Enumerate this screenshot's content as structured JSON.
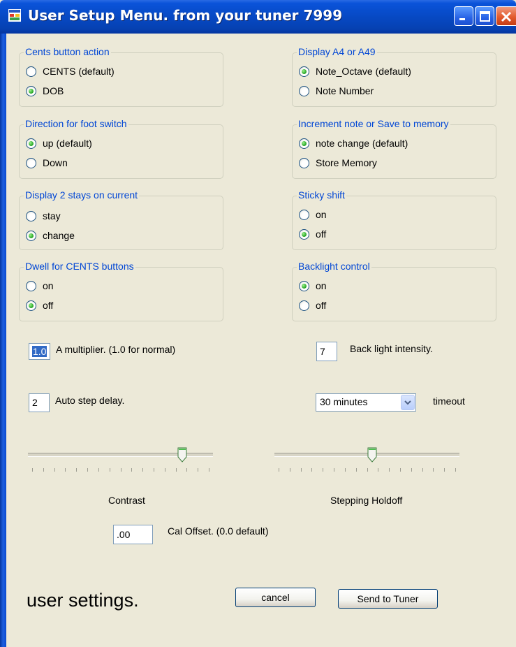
{
  "window": {
    "title": "User Setup Menu.  from your tuner 7999",
    "controls": [
      "minimize-icon",
      "maximize-icon",
      "close-icon"
    ]
  },
  "groups": [
    {
      "id": "cents",
      "legend": "Cents button action",
      "options": [
        {
          "label": "CENTS (default)",
          "checked": false
        },
        {
          "label": "DOB",
          "checked": true
        }
      ]
    },
    {
      "id": "display-a4",
      "legend": "Display A4 or A49",
      "options": [
        {
          "label": "Note_Octave (default)",
          "checked": true
        },
        {
          "label": "Note Number",
          "checked": false
        }
      ]
    },
    {
      "id": "footswitch",
      "legend": "Direction for foot switch",
      "options": [
        {
          "label": "up (default)",
          "checked": true
        },
        {
          "label": "Down",
          "checked": false
        }
      ]
    },
    {
      "id": "increment",
      "legend": "Increment note or Save to memory",
      "options": [
        {
          "label": "note change (default)",
          "checked": true
        },
        {
          "label": "Store Memory",
          "checked": false
        }
      ]
    },
    {
      "id": "display2",
      "legend": "Display 2 stays on current",
      "options": [
        {
          "label": "stay",
          "checked": false
        },
        {
          "label": "change",
          "checked": true
        }
      ]
    },
    {
      "id": "sticky",
      "legend": "Sticky shift",
      "options": [
        {
          "label": "on",
          "checked": false
        },
        {
          "label": "off",
          "checked": true
        }
      ]
    },
    {
      "id": "dwell",
      "legend": "Dwell for CENTS buttons",
      "options": [
        {
          "label": "on",
          "checked": false
        },
        {
          "label": "off",
          "checked": true
        }
      ]
    },
    {
      "id": "backlight",
      "legend": "Backlight control",
      "options": [
        {
          "label": "on",
          "checked": true
        },
        {
          "label": "off",
          "checked": false
        }
      ]
    }
  ],
  "fields": {
    "a_multiplier": {
      "value": "1.0",
      "label": "A multiplier. (1.0 for normal)"
    },
    "backlight_intensity": {
      "value": "7",
      "label": "Back light intensity."
    },
    "auto_step_delay": {
      "value": "2",
      "label": "Auto step delay."
    },
    "timeout": {
      "value": "30 minutes",
      "label": "timeout"
    },
    "cal_offset": {
      "value": ".00",
      "label": "Cal Offset. (0.0 default)"
    }
  },
  "sliders": {
    "contrast": {
      "label": "Contrast",
      "level": 0.85,
      "ticks": 17
    },
    "stepping_holdoff": {
      "label": "Stepping Holdoff",
      "level": 0.53,
      "ticks": 17
    }
  },
  "buttons": {
    "cancel": "cancel",
    "send": "Send to Tuner"
  },
  "footer_text": "user settings.",
  "colors": {
    "legend": "#0046d5",
    "background": "#ece9d8",
    "titlebar": "#0a53d9"
  }
}
